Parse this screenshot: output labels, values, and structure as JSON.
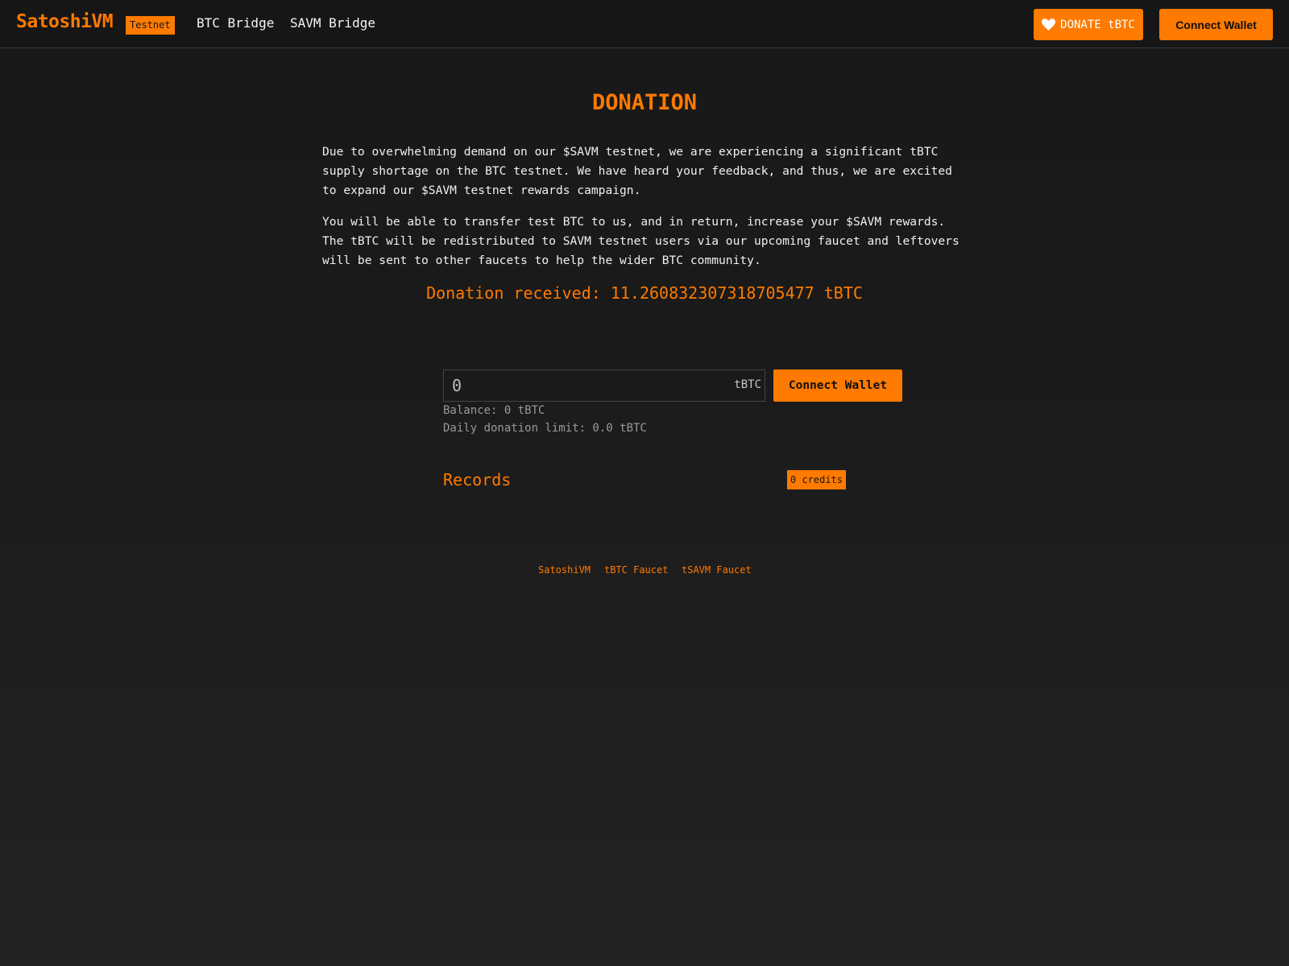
{
  "header": {
    "logo": "SatoshiVM",
    "badge": "Testnet",
    "nav": [
      {
        "label": "BTC Bridge"
      },
      {
        "label": "SAVM Bridge"
      }
    ],
    "donate_button": {
      "label": "DONATE tBTC",
      "icon": "heart-icon"
    },
    "connect_button": "Connect Wallet"
  },
  "main": {
    "title": "DONATION",
    "paragraphs": [
      "Due to overwhelming demand on our $SAVM testnet, we are experiencing a significant tBTC supply shortage on the BTC testnet. We have heard your feedback, and thus, we are excited to expand our $SAVM testnet rewards campaign.",
      "You will be able to transfer test BTC to us, and in return, increase your $SAVM rewards. The tBTC will be redistributed to SAVM testnet users via our upcoming faucet and leftovers will be sent to other faucets to help the wider BTC community."
    ],
    "donation_received": "Donation received: 11.260832307318705477 tBTC",
    "amount_input": {
      "placeholder": "0",
      "unit": "tBTC"
    },
    "connect_button": "Connect Wallet",
    "balance": "Balance: 0 tBTC",
    "daily_limit": "Daily donation limit: 0.0 tBTC",
    "records_title": "Records",
    "credits": "0 credits"
  },
  "footer": {
    "links": [
      {
        "label": "SatoshiVM"
      },
      {
        "label": "tBTC Faucet"
      },
      {
        "label": "tSAVM Faucet"
      }
    ]
  },
  "colors": {
    "accent": "#ff7a00",
    "background": "#1b1b1b",
    "header_bg": "#161616",
    "text": "#f2f2f2",
    "muted": "#9a9a9a"
  }
}
